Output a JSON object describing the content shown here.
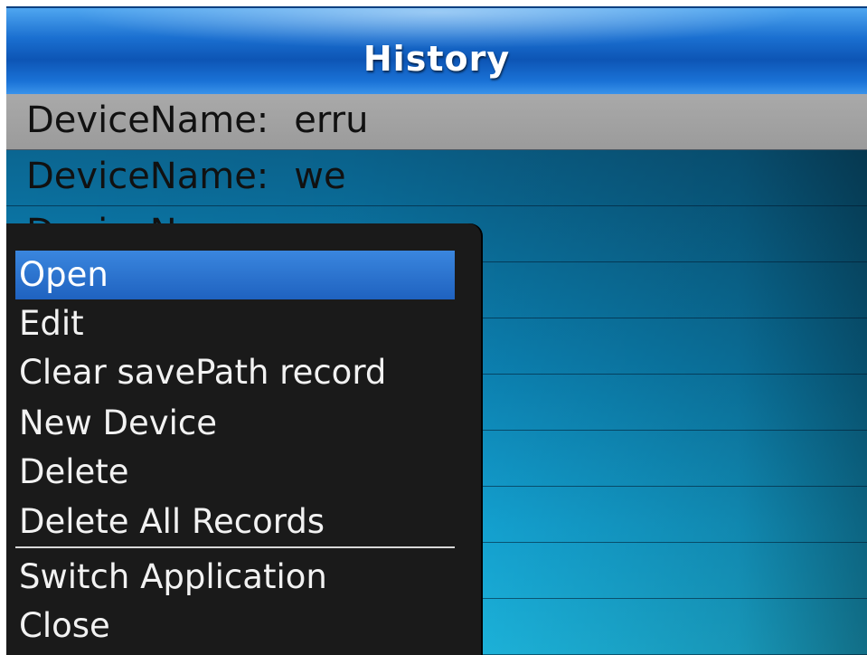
{
  "title": "History",
  "records": [
    {
      "label": "DeviceName:",
      "value": "erru",
      "selected": true
    },
    {
      "label": "DeviceName:",
      "value": "we",
      "selected": false
    },
    {
      "label": "DeviceName:",
      "value": "",
      "selected": false
    },
    {
      "label": "",
      "value": "",
      "selected": false
    },
    {
      "label": "",
      "value": "",
      "selected": false
    },
    {
      "label": "",
      "value": "",
      "selected": false
    },
    {
      "label": "",
      "value": "",
      "selected": false
    },
    {
      "label": "",
      "value": "",
      "selected": false
    },
    {
      "label": "",
      "value": "",
      "selected": false
    },
    {
      "label": "",
      "value": "",
      "selected": false
    }
  ],
  "menu": {
    "items": [
      {
        "label": "Open",
        "highlighted": true
      },
      {
        "label": "Edit",
        "highlighted": false
      },
      {
        "label": "Clear savePath record",
        "highlighted": false
      },
      {
        "label": "New Device",
        "highlighted": false
      },
      {
        "label": "Delete",
        "highlighted": false
      },
      {
        "label": "Delete All Records",
        "highlighted": false
      },
      {
        "label": "Switch Application",
        "highlighted": false
      },
      {
        "label": "Close",
        "highlighted": false
      }
    ]
  },
  "colors": {
    "title_bar": "#1a6fd0",
    "selected_row": "#a0a0a0",
    "menu_background": "#1a1a1a",
    "menu_highlight": "#2a74d0"
  }
}
